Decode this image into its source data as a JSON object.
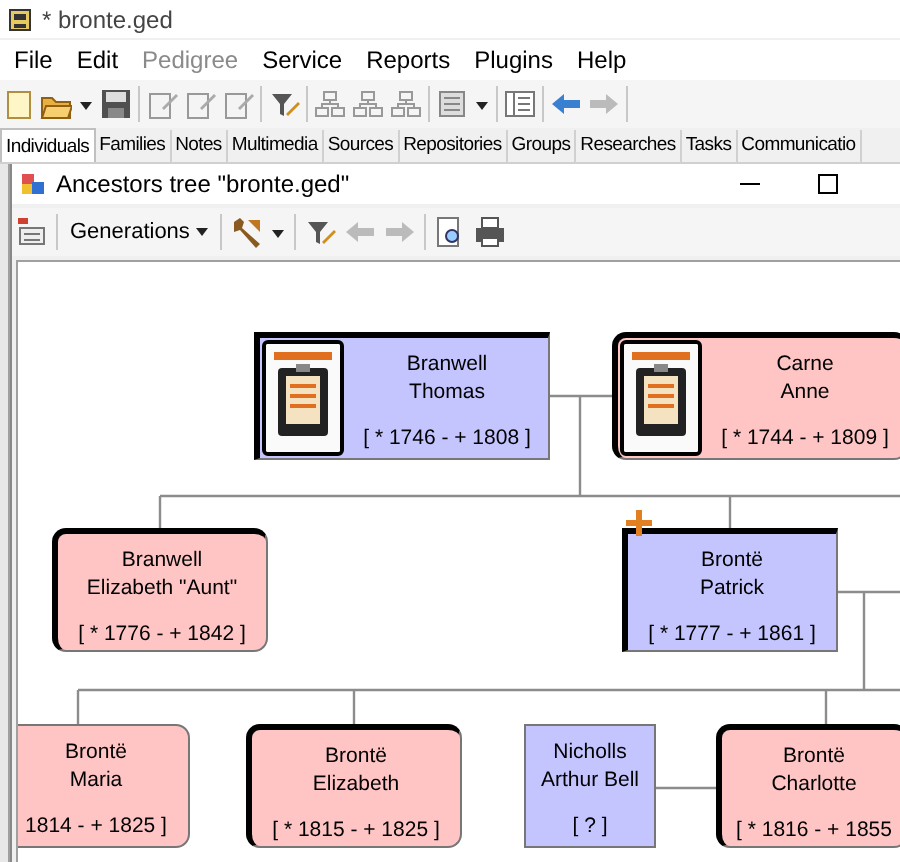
{
  "window": {
    "title": "* bronte.ged"
  },
  "menu": [
    {
      "label": "File",
      "disabled": false
    },
    {
      "label": "Edit",
      "disabled": false
    },
    {
      "label": "Pedigree",
      "disabled": true
    },
    {
      "label": "Service",
      "disabled": false
    },
    {
      "label": "Reports",
      "disabled": false
    },
    {
      "label": "Plugins",
      "disabled": false
    },
    {
      "label": "Help",
      "disabled": false
    }
  ],
  "tabs": [
    {
      "label": "Individuals",
      "selected": true
    },
    {
      "label": "Families",
      "selected": false
    },
    {
      "label": "Notes",
      "selected": false
    },
    {
      "label": "Multimedia",
      "selected": false
    },
    {
      "label": "Sources",
      "selected": false
    },
    {
      "label": "Repositories",
      "selected": false
    },
    {
      "label": "Groups",
      "selected": false
    },
    {
      "label": "Researches",
      "selected": false
    },
    {
      "label": "Tasks",
      "selected": false
    },
    {
      "label": "Communicatio",
      "selected": false
    }
  ],
  "tree_window": {
    "title": "Ancestors tree \"bronte.ged\"",
    "toolbar": {
      "generations_button": "Generations"
    }
  },
  "people": [
    {
      "surname": "Branwell",
      "given": "Thomas",
      "dates": "[ * 1746 - + 1808 ]",
      "kind": "male",
      "framed": true,
      "photo": true,
      "root": false
    },
    {
      "surname": "Carne",
      "given": "Anne",
      "dates": "[ * 1744 - + 1809 ]",
      "kind": "female",
      "framed": true,
      "photo": true,
      "root": false
    },
    {
      "surname": "Branwell",
      "given": "Elizabeth \"Aunt\"",
      "dates": "[ * 1776 - + 1842 ]",
      "kind": "female",
      "framed": true,
      "photo": false,
      "root": false
    },
    {
      "surname": "Brontë",
      "given": "Patrick",
      "dates": "[ * 1777 - + 1861 ]",
      "kind": "male",
      "framed": true,
      "photo": false,
      "root": true
    },
    {
      "surname": "Brontë",
      "given": "Maria",
      "dates": "1814 - + 1825 ]",
      "kind": "female",
      "framed": false,
      "photo": false,
      "root": false
    },
    {
      "surname": "Brontë",
      "given": "Elizabeth",
      "dates": "[ * 1815 - + 1825 ]",
      "kind": "female",
      "framed": true,
      "photo": false,
      "root": false
    },
    {
      "surname": "Nicholls",
      "given": "Arthur Bell",
      "dates": "[ ? ]",
      "kind": "male",
      "framed": false,
      "photo": false,
      "root": false
    },
    {
      "surname": "Brontë",
      "given": "Charlotte",
      "dates": "[ * 1816 - + 1855",
      "kind": "female",
      "framed": true,
      "photo": false,
      "root": false
    }
  ]
}
